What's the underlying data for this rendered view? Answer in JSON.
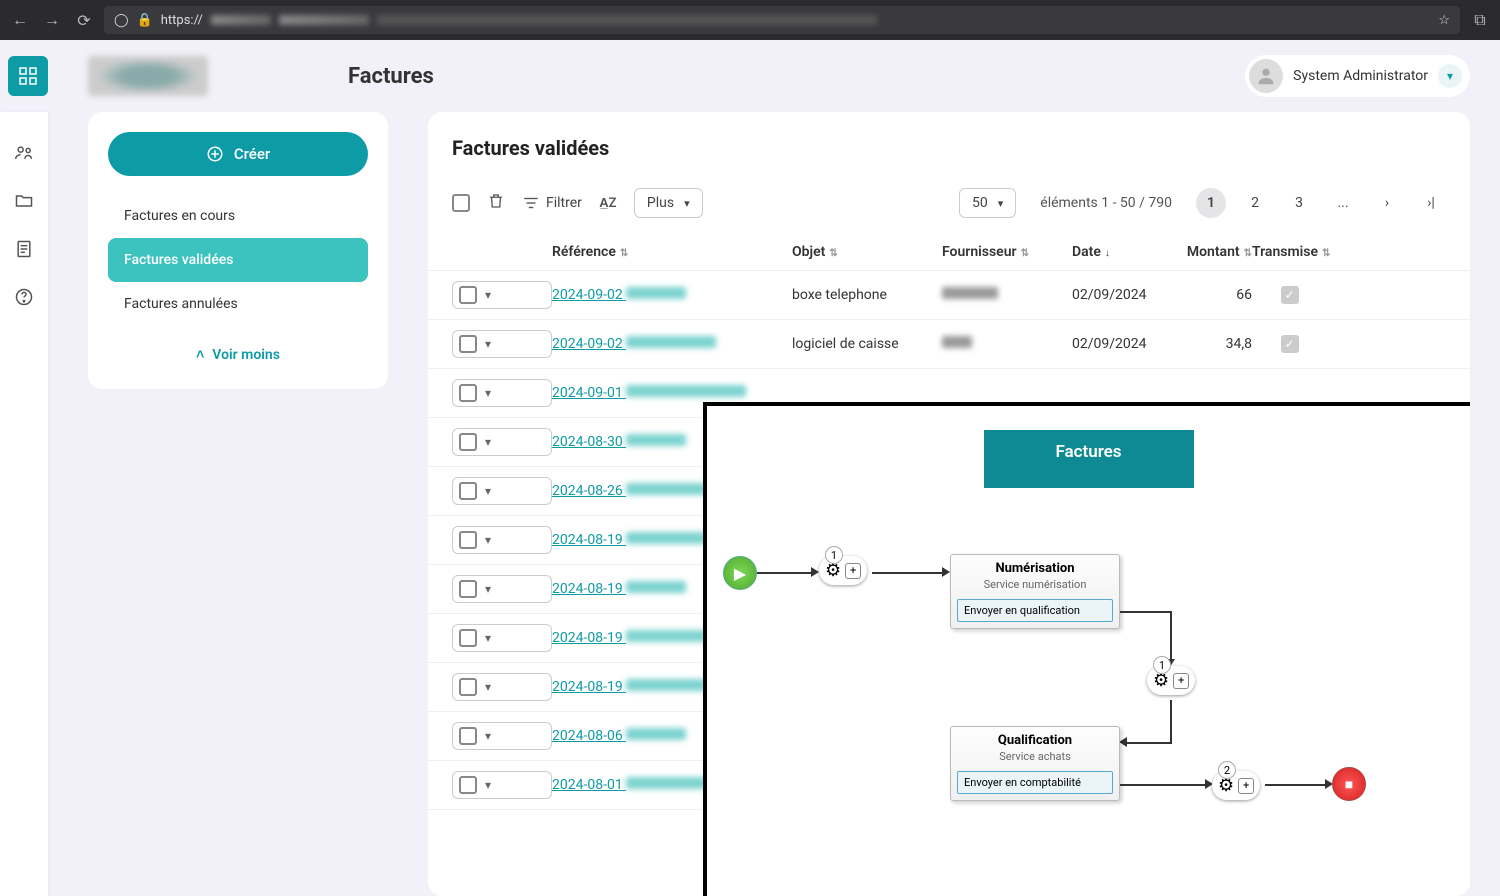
{
  "browser": {
    "url_prefix": "https://",
    "star_icon": "star-icon",
    "ext_icon": "extension-icon"
  },
  "header": {
    "title": "Factures",
    "user_name": "System Administrator"
  },
  "sidebar": {
    "create_label": "Créer",
    "items": [
      {
        "label": "Factures en cours"
      },
      {
        "label": "Factures validées"
      },
      {
        "label": "Factures annulées"
      }
    ],
    "see_less": "Voir moins"
  },
  "content": {
    "title": "Factures validées",
    "filter_label": "Filtrer",
    "plus_label": "Plus",
    "page_size": "50",
    "page_info": "éléments 1 - 50 / 790",
    "pages": [
      "1",
      "2",
      "3",
      "..."
    ],
    "columns": {
      "reference": "Référence",
      "objet": "Objet",
      "fournisseur": "Fournisseur",
      "date": "Date",
      "montant": "Montant",
      "transmise": "Transmise"
    },
    "rows": [
      {
        "ref_prefix": "2024-09-02",
        "objet": "boxe telephone",
        "date": "02/09/2024",
        "montant": "66",
        "trans": true,
        "four_w": 56
      },
      {
        "ref_prefix": "2024-09-02",
        "objet": "logiciel de caisse",
        "date": "02/09/2024",
        "montant": "34,8",
        "trans": true,
        "four_w": 30
      },
      {
        "ref_prefix": "2024-09-01",
        "objet": "",
        "date": "",
        "montant": "",
        "trans": null,
        "four_w": 0
      },
      {
        "ref_prefix": "2024-08-30",
        "objet": "",
        "date": "",
        "montant": "",
        "trans": null,
        "four_w": 0
      },
      {
        "ref_prefix": "2024-08-26",
        "objet": "",
        "date": "",
        "montant": "",
        "trans": null,
        "four_w": 0
      },
      {
        "ref_prefix": "2024-08-19",
        "objet": "",
        "date": "",
        "montant": "",
        "trans": null,
        "four_w": 0
      },
      {
        "ref_prefix": "2024-08-19",
        "objet": "",
        "date": "",
        "montant": "",
        "trans": null,
        "four_w": 0
      },
      {
        "ref_prefix": "2024-08-19",
        "objet": "",
        "date": "",
        "montant": "",
        "trans": null,
        "four_w": 0
      },
      {
        "ref_prefix": "2024-08-19",
        "objet": "",
        "date": "",
        "montant": "",
        "trans": null,
        "four_w": 0
      },
      {
        "ref_prefix": "2024-08-06",
        "objet": "",
        "date": "",
        "montant": "",
        "trans": null,
        "four_w": 0
      },
      {
        "ref_prefix": "2024-08-01",
        "objet": "",
        "date": "",
        "montant": "",
        "trans": null,
        "four_w": 0
      }
    ]
  },
  "workflow": {
    "title": "Factures",
    "node1": {
      "badge": "1"
    },
    "card1": {
      "title": "Numérisation",
      "sub": "Service numérisation",
      "action": "Envoyer en qualification"
    },
    "node2": {
      "badge": "1"
    },
    "card2": {
      "title": "Qualification",
      "sub": "Service achats",
      "action": "Envoyer en comptabilité"
    },
    "node3": {
      "badge": "2"
    }
  }
}
